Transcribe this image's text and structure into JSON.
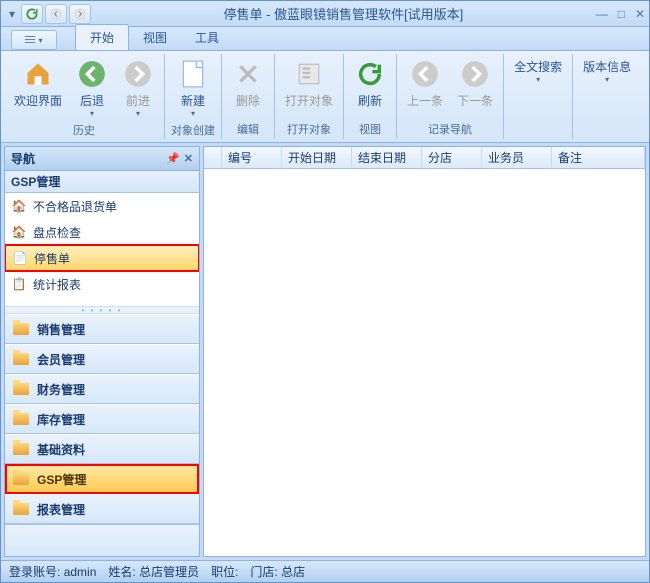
{
  "title": "停售单 - 傲蓝眼镜销售管理软件[试用版本]",
  "ribbon_tabs": {
    "begin": "开始",
    "view": "视图",
    "tools": "工具"
  },
  "ribbon": {
    "history": {
      "label": "历史",
      "welcome": "欢迎界面",
      "back": "后退",
      "forward": "前进"
    },
    "create": {
      "label": "对象创建",
      "new": "新建"
    },
    "edit": {
      "label": "编辑",
      "delete": "删除"
    },
    "open": {
      "label": "打开对象",
      "open_obj": "打开对象"
    },
    "viewg": {
      "label": "视图",
      "refresh": "刷新"
    },
    "record_nav": {
      "label": "记录导航",
      "prev": "上一条",
      "next": "下一条"
    },
    "fullsearch": "全文搜索",
    "version": "版本信息"
  },
  "nav": {
    "title": "导航",
    "group_title": "GSP管理",
    "items": {
      "return": "不合格品退货单",
      "check": "盘点检查",
      "stop": "停售单",
      "report": "统计报表"
    },
    "groups": {
      "sales": "销售管理",
      "member": "会员管理",
      "finance": "财务管理",
      "stock": "库存管理",
      "base": "基础资料",
      "gsp": "GSP管理",
      "reportmgr": "报表管理"
    }
  },
  "grid": {
    "cols": {
      "id": "编号",
      "start": "开始日期",
      "end": "结束日期",
      "branch": "分店",
      "staff": "业务员",
      "remark": "备注"
    }
  },
  "status": {
    "account_label": "登录账号:",
    "account": "admin",
    "name_label": "姓名:",
    "name": "总店管理员",
    "role_label": "职位:",
    "store_label": "门店:",
    "store": "总店"
  }
}
